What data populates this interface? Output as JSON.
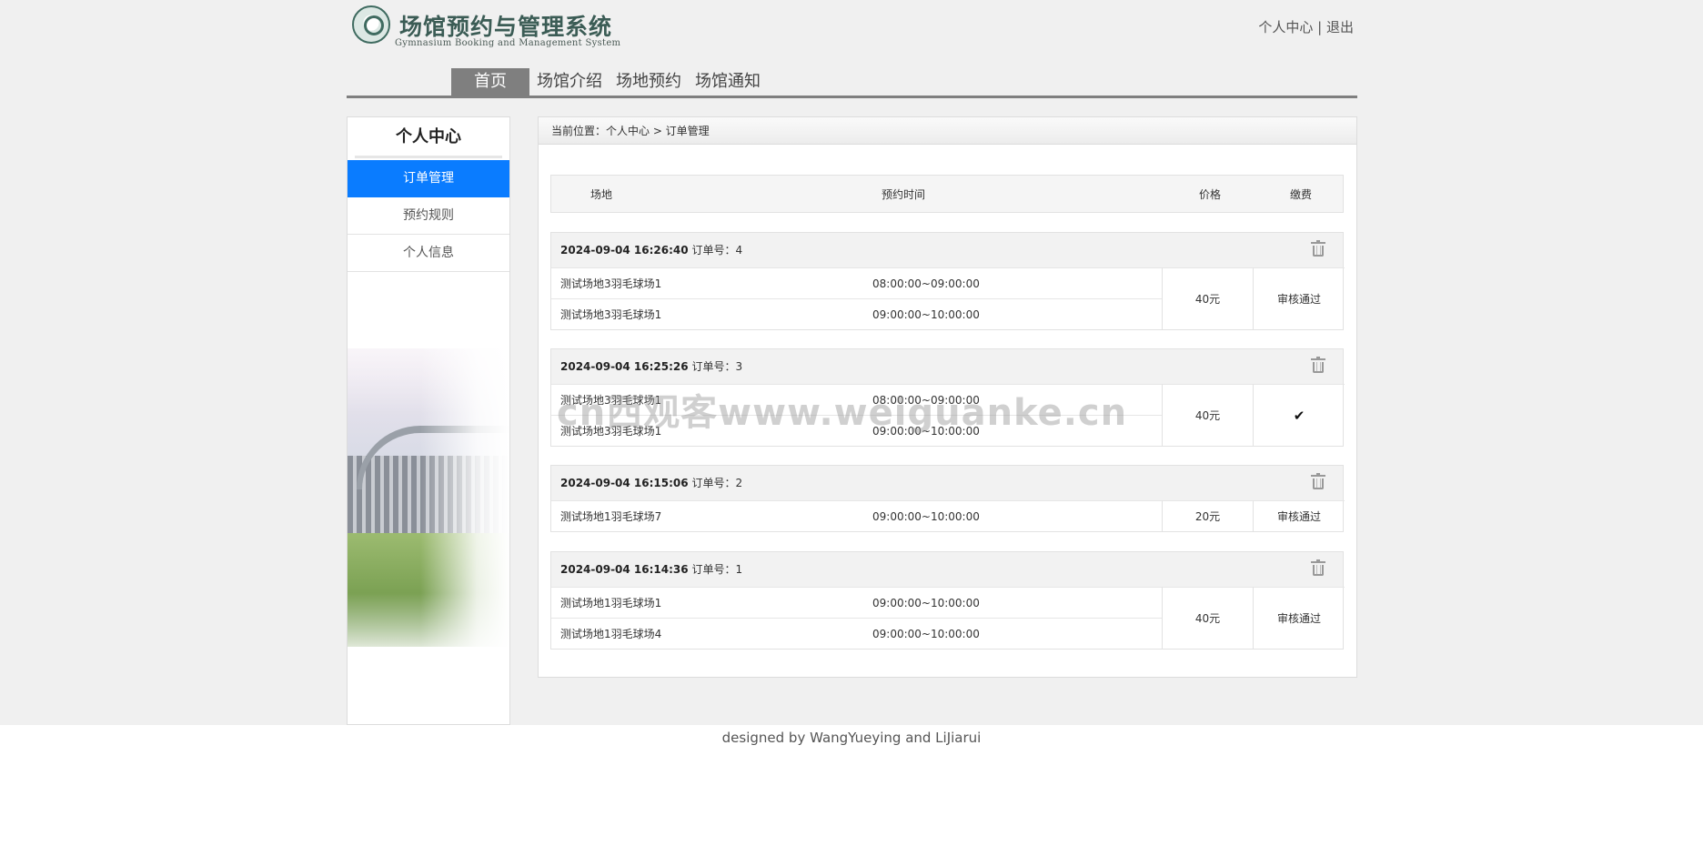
{
  "header": {
    "logo_title": "场馆预约与管理系统",
    "logo_subtitle": "Gymnasium Booking and Management System",
    "user_center": "个人中心",
    "separator": "|",
    "logout": "退出"
  },
  "nav": {
    "items": [
      "首页",
      "场馆介绍",
      "场地预约",
      "场馆通知"
    ]
  },
  "sidebar": {
    "title": "个人中心",
    "items": [
      "订单管理",
      "预约规则",
      "个人信息"
    ]
  },
  "breadcrumb": "当前位置：个人中心 > 订单管理",
  "table": {
    "headers": [
      "场地",
      "预约时间",
      "价格",
      "缴费"
    ]
  },
  "orders": [
    {
      "datetime": "2024-09-04 16:26:40",
      "order_label": "订单号：4",
      "rows": [
        {
          "venue": "测试场地3羽毛球场1",
          "time": "08:00:00~09:00:00"
        },
        {
          "venue": "测试场地3羽毛球场1",
          "time": "09:00:00~10:00:00"
        }
      ],
      "price": "40元",
      "status": "审核通过"
    },
    {
      "datetime": "2024-09-04 16:25:26",
      "order_label": "订单号：3",
      "rows": [
        {
          "venue": "测试场地3羽毛球场1",
          "time": "08:00:00~09:00:00"
        },
        {
          "venue": "测试场地3羽毛球场1",
          "time": "09:00:00~10:00:00"
        }
      ],
      "price": "40元",
      "status": "✔"
    },
    {
      "datetime": "2024-09-04 16:15:06",
      "order_label": "订单号：2",
      "rows": [
        {
          "venue": "测试场地1羽毛球场7",
          "time": "09:00:00~10:00:00"
        }
      ],
      "price": "20元",
      "status": "审核通过"
    },
    {
      "datetime": "2024-09-04 16:14:36",
      "order_label": "订单号：1",
      "rows": [
        {
          "venue": "测试场地1羽毛球场1",
          "time": "09:00:00~10:00:00"
        },
        {
          "venue": "测试场地1羽毛球场4",
          "time": "09:00:00~10:00:00"
        }
      ],
      "price": "40元",
      "status": "审核通过"
    }
  ],
  "watermark": "cn西观客www.weiguanke.cn",
  "footer": "designed by WangYueying and LiJiarui",
  "colors": {
    "nav_active": "#7f7f7f",
    "sidebar_active": "#0a7cff",
    "page_bg": "#f0f0f0"
  },
  "icons": {
    "order_delete": "trash-icon",
    "paid": "check-icon"
  }
}
